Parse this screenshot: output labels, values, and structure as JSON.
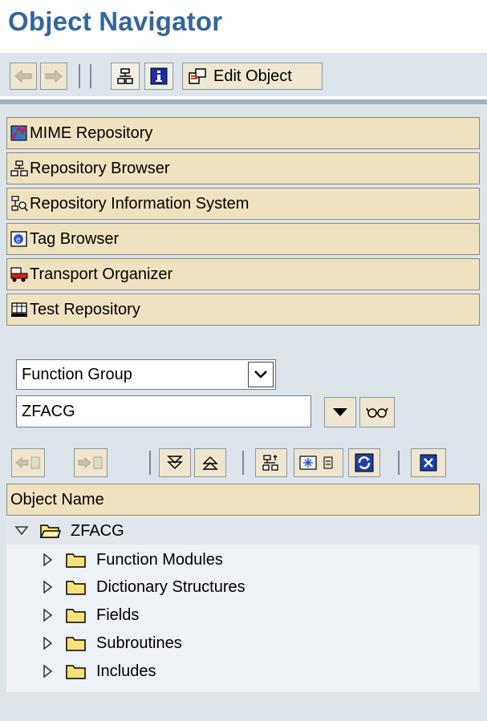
{
  "page": {
    "title": "Object Navigator"
  },
  "toolbar": {
    "back_icon": "back-arrow-icon",
    "forward_icon": "forward-arrow-icon",
    "edit_object_label": "Edit Object"
  },
  "repository_buttons": [
    {
      "label": "MIME Repository",
      "icon": "mime-repository-icon"
    },
    {
      "label": "Repository Browser",
      "icon": "repository-browser-icon"
    },
    {
      "label": "Repository Information System",
      "icon": "repository-info-system-icon"
    },
    {
      "label": "Tag Browser",
      "icon": "tag-browser-icon"
    },
    {
      "label": "Transport Organizer",
      "icon": "transport-organizer-icon"
    },
    {
      "label": "Test Repository",
      "icon": "test-repository-icon"
    }
  ],
  "object_selector": {
    "type_value": "Function Group",
    "name_value": "ZFACG"
  },
  "tree": {
    "column_header": "Object Name",
    "root": {
      "label": "ZFACG"
    },
    "children": [
      {
        "label": "Function Modules"
      },
      {
        "label": "Dictionary Structures"
      },
      {
        "label": "Fields"
      },
      {
        "label": "Subroutines"
      },
      {
        "label": "Includes"
      }
    ]
  },
  "colors": {
    "title": "#336699",
    "panel_bg": "#dde4ea",
    "button_bg": "#efe2bf"
  }
}
